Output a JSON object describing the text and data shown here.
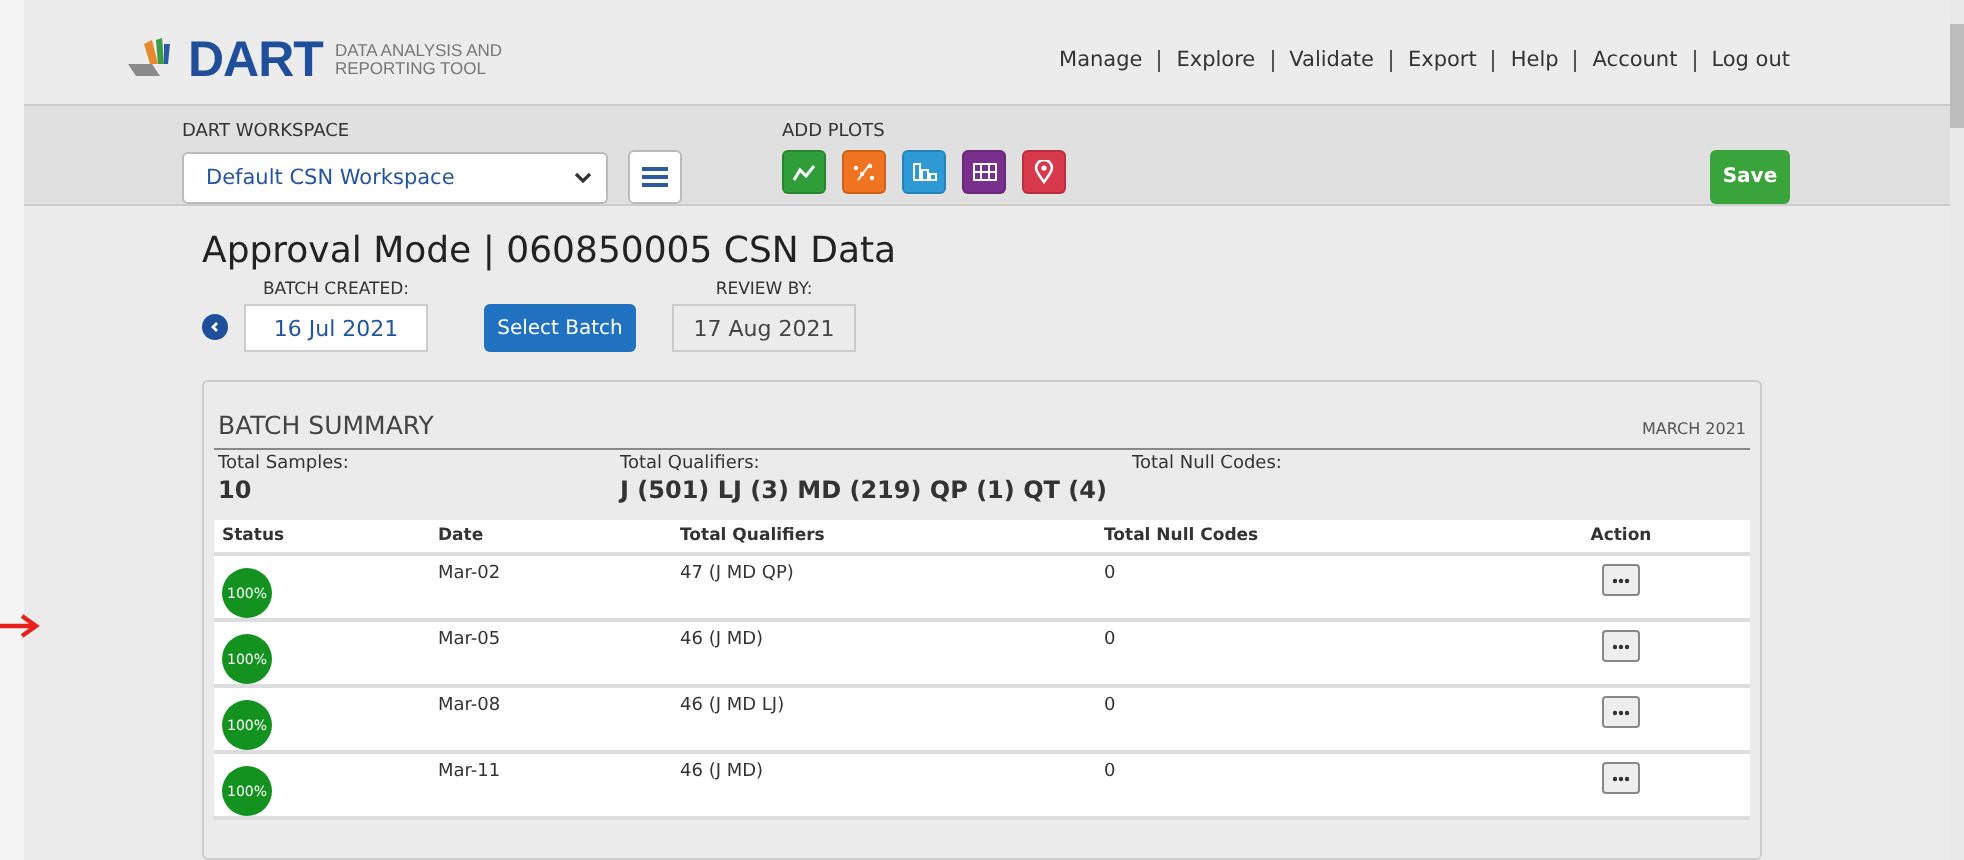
{
  "header": {
    "logo": {
      "mark": "DART",
      "subtitle": [
        "DATA ANALYSIS AND",
        "REPORTING TOOL"
      ]
    },
    "nav": [
      "Manage",
      "Explore",
      "Validate",
      "Export",
      "Help",
      "Account",
      "Log out"
    ]
  },
  "toolbar": {
    "workspace_label": "DART WORKSPACE",
    "workspace": "Default CSN Workspace",
    "add_plots_label": "ADD PLOTS",
    "plots": [
      {
        "kind": "line",
        "color": "#2f9e3a"
      },
      {
        "kind": "scatter",
        "color": "#f07322"
      },
      {
        "kind": "bar",
        "color": "#2d9ad6"
      },
      {
        "kind": "grid",
        "color": "#7b2f8d"
      },
      {
        "kind": "map",
        "color": "#d8394b"
      }
    ],
    "save": "Save"
  },
  "title": "Approval Mode | 060850005 CSN Data",
  "batch": {
    "created_label": "BATCH CREATED:",
    "created": "16 Jul 2021",
    "select": "Select Batch",
    "review_label": "REVIEW BY:",
    "review": "17 Aug 2021"
  },
  "summary": {
    "title": "BATCH SUMMARY",
    "month": "MARCH 2021",
    "stats": [
      {
        "label": "Total Samples:",
        "value": "10"
      },
      {
        "label": "Total Qualifiers:",
        "value": "J (501) LJ (3) MD (219) QP (1) QT (4)"
      },
      {
        "label": "Total Null Codes:"
      }
    ],
    "table": {
      "columns": [
        "Status",
        "Date",
        "Total Qualifiers",
        "Total Null Codes",
        "Action"
      ],
      "rows": [
        {
          "status": "100%",
          "date": "Mar-02",
          "qualifiers": "47 (J MD QP)",
          "null_codes": "0"
        },
        {
          "status": "100%",
          "date": "Mar-05",
          "qualifiers": "46 (J MD)",
          "null_codes": "0"
        },
        {
          "status": "100%",
          "date": "Mar-08",
          "qualifiers": "46 (J MD LJ)",
          "null_codes": "0"
        },
        {
          "status": "100%",
          "date": "Mar-11",
          "qualifiers": "46 (J MD)",
          "null_codes": "0"
        }
      ]
    }
  }
}
